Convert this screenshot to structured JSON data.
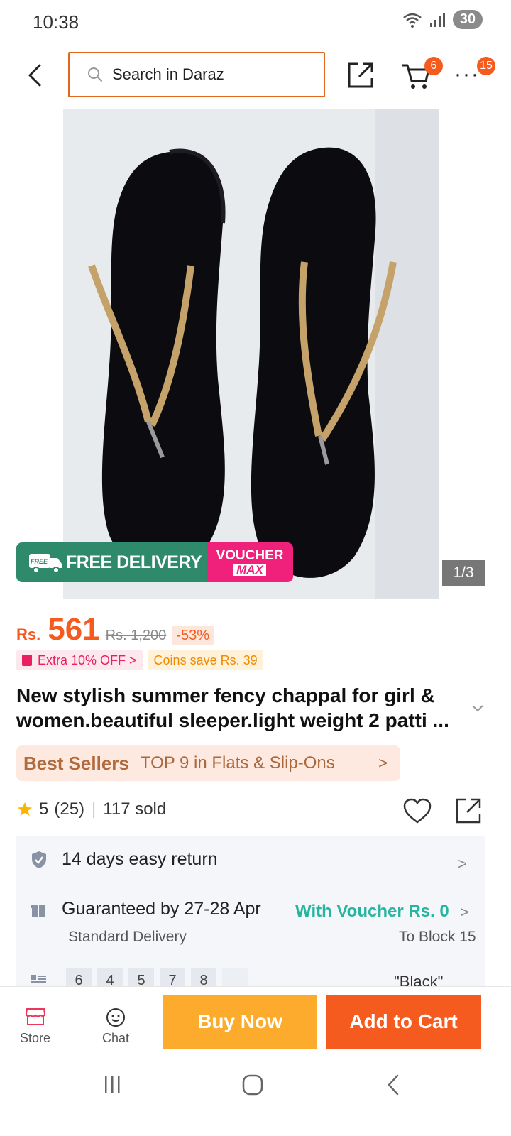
{
  "status_bar": {
    "time": "10:38",
    "battery": "30"
  },
  "header": {
    "search_placeholder": "Search in Daraz",
    "cart_count": "6",
    "more_count": "15"
  },
  "gallery": {
    "counter": "1/3"
  },
  "banner": {
    "free_label": "FREE",
    "free_delivery": "FREE DELIVERY",
    "voucher": "VOUCHER",
    "max": "MAX"
  },
  "price": {
    "currency": "Rs.",
    "current": "561",
    "original": "Rs. 1,200",
    "discount": "-53%"
  },
  "promos": {
    "extra_off": "Extra 10% OFF  >",
    "coins": "Coins save Rs. 39"
  },
  "product": {
    "title": "New stylish summer fency chappal for girl & women.beautiful sleeper.light weight 2 patti ..."
  },
  "best_seller": {
    "title": "Best Sellers",
    "text": "TOP 9 in Flats & Slip-Ons",
    "chevron": ">"
  },
  "rating": {
    "score": "5",
    "count": "(25)",
    "sold": "117 sold"
  },
  "info": {
    "return_text": "14 days easy return",
    "delivery_text": "Guaranteed by 27-28 Apr",
    "voucher_text": "With Voucher Rs. 0",
    "delivery_type": "Standard Delivery",
    "destination": "To Block 15",
    "sizes": [
      "6",
      "4",
      "5",
      "7",
      "8"
    ],
    "color": "\"Black\"",
    "chevron": ">"
  },
  "bottom_bar": {
    "store": "Store",
    "chat": "Chat",
    "buy_now": "Buy Now",
    "add_to_cart": "Add to Cart"
  },
  "colors": {
    "accent": "#f55a1e",
    "search_border": "#e2661b",
    "buy_now": "#fcab2c",
    "free_delivery": "#2e8a6a",
    "voucher": "#f0217a",
    "teal": "#26b5a0"
  }
}
